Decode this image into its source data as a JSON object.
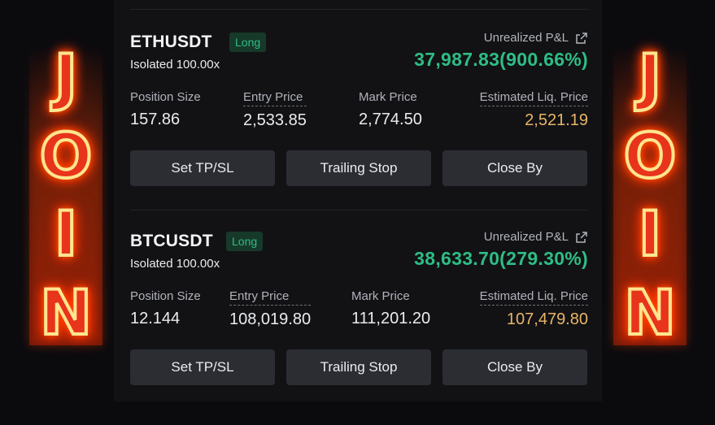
{
  "positions": [
    {
      "symbol": "ETHUSDT",
      "side": "Long",
      "margin_mode": "Isolated 100.00x",
      "pnl_label": "Unrealized P&L",
      "pnl_value": "37,987.83(900.66%)",
      "position_size_label": "Position Size",
      "position_size": "157.86",
      "entry_price_label": "Entry Price",
      "entry_price": "2,533.85",
      "mark_price_label": "Mark Price",
      "mark_price": "2,774.50",
      "liq_price_label": "Estimated Liq. Price",
      "liq_price": "2,521.19",
      "buttons": [
        "Set TP/SL",
        "Trailing Stop",
        "Close By"
      ]
    },
    {
      "symbol": "BTCUSDT",
      "side": "Long",
      "margin_mode": "Isolated 100.00x",
      "pnl_label": "Unrealized P&L",
      "pnl_value": "38,633.70(279.30%)",
      "position_size_label": "Position Size",
      "position_size": "12.144",
      "entry_price_label": "Entry Price",
      "entry_price": "108,019.80",
      "mark_price_label": "Mark Price",
      "mark_price": "111,201.20",
      "liq_price_label": "Estimated Liq. Price",
      "liq_price": "107,479.80",
      "buttons": [
        "Set TP/SL",
        "Trailing Stop",
        "Close By"
      ]
    }
  ],
  "overlay": {
    "left_letters": [
      "J",
      "O",
      "I",
      "N"
    ],
    "right_letters": [
      "J",
      "O",
      "I",
      "N"
    ]
  },
  "colors": {
    "profit": "#2ebd85",
    "liq": "#e8b567",
    "button_bg": "#2b2d33"
  }
}
